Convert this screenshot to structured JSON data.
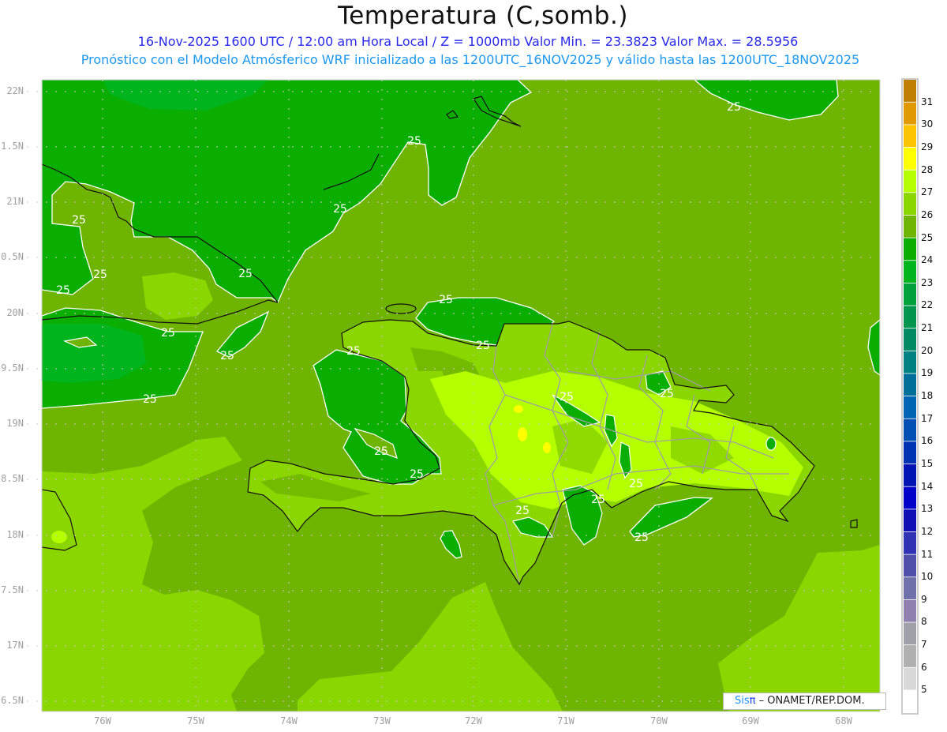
{
  "header": {
    "title": "Temperatura (C,somb.)",
    "subtitle": "16-Nov-2025 1600 UTC / 12:00 am Hora Local / Z = 1000mb   Valor Min. = 23.3823   Valor Max. = 28.5956",
    "model_info": "Pronóstico con el Modelo Atmósferico WRF inicializado a las 1200UTC_16NOV2025 y válido hasta las  1200UTC_18NOV2025"
  },
  "map": {
    "lat_labels": [
      "22N",
      "1.5N",
      "21N",
      "0.5N",
      "20N",
      "9.5N",
      "19N",
      "8.5N",
      "18N",
      "7.5N",
      "17N",
      "6.5N"
    ],
    "lon_labels": [
      "76W",
      "75W",
      "74W",
      "73W",
      "72W",
      "71W",
      "70W",
      "69W",
      "68W"
    ],
    "contour_label": "25"
  },
  "colorbar": {
    "labels": [
      "31",
      "30",
      "29",
      "28",
      "27",
      "26",
      "25",
      "24",
      "23",
      "22",
      "21",
      "20",
      "19",
      "18",
      "17",
      "16",
      "15",
      "14",
      "13",
      "12",
      "11",
      "10",
      "9",
      "8",
      "7",
      "6",
      "5"
    ],
    "colors": [
      "#bf7f00",
      "#e09a00",
      "#ffc400",
      "#ffff00",
      "#b4ff00",
      "#8cd600",
      "#6eb400",
      "#0aae00",
      "#00b41e",
      "#00a03c",
      "#009650",
      "#008a64",
      "#008080",
      "#00709a",
      "#0064b4",
      "#0050b4",
      "#0032b4",
      "#0014b4",
      "#0000c8",
      "#1010b4",
      "#3232b4",
      "#5050aa",
      "#7070aa",
      "#9080b0",
      "#a0a0a8",
      "#b0b0b0",
      "#d8d8d8",
      "#ffffff"
    ]
  },
  "credit": {
    "sis": "Sis",
    "pi": "π",
    "org": " –  ONAMET/REP.DOM."
  }
}
